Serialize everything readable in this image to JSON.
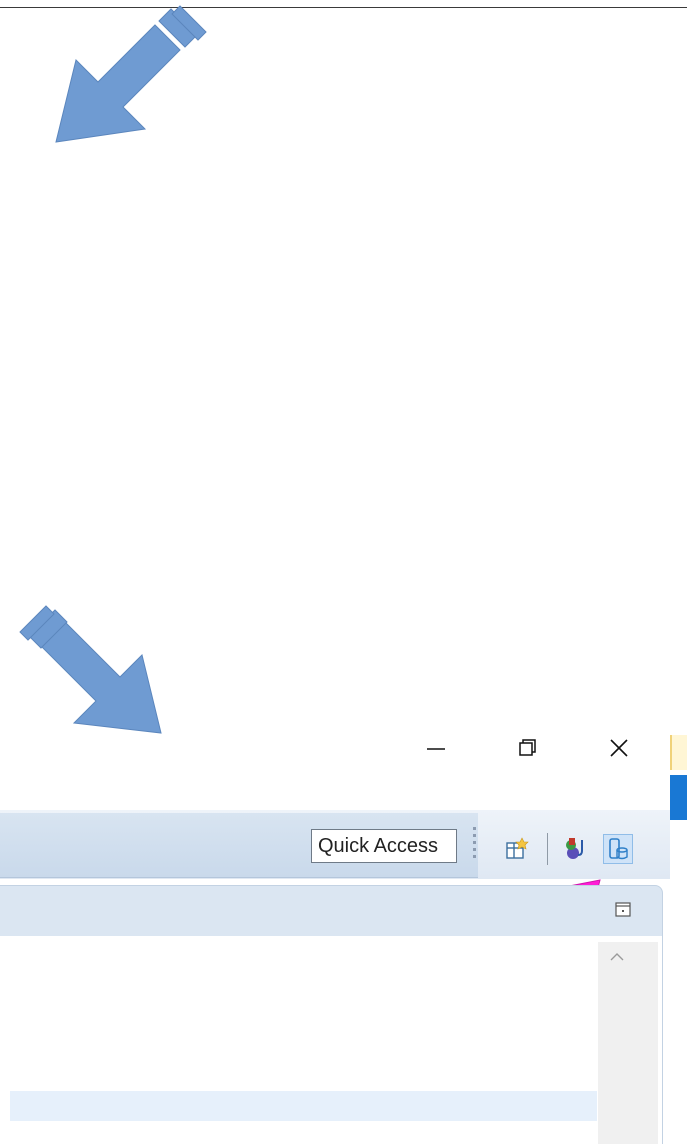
{
  "window_controls": {
    "minimize_icon": "minimize-icon",
    "restore_icon": "restore-icon",
    "close_icon": "close-icon"
  },
  "toolbar": {
    "quick_access_label": "Quick Access",
    "icons": [
      "open-perspective-icon",
      "java-perspective-icon",
      "database-perspective-icon"
    ]
  },
  "view_tabs": {
    "maximize_icon": "maximize-view-icon"
  },
  "content": {
    "scroll_up_icon": "chevron-up-icon"
  },
  "annotations": {
    "arrow_color_blue": "#6f9bd2",
    "arrow_color_magenta": "#ff1dd6"
  }
}
